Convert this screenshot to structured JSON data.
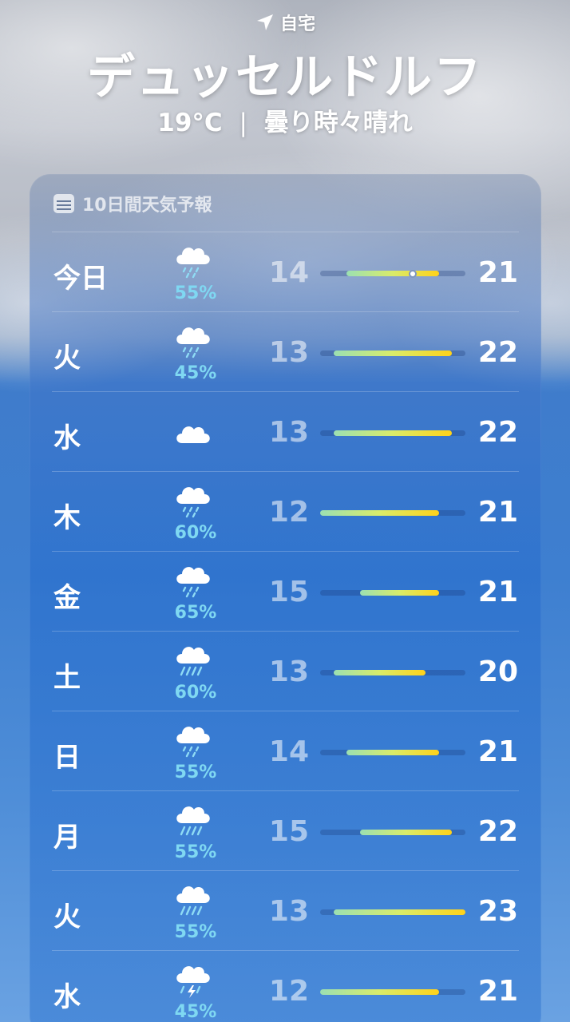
{
  "header": {
    "location_label": "自宅",
    "city": "デュッセルドルフ",
    "current_temp": "19°C",
    "separator": "|",
    "condition": "曇り時々晴れ"
  },
  "forecast": {
    "title": "10日間天気予報",
    "range_min": 12,
    "range_max": 23,
    "current_temp_value": 19,
    "days": [
      {
        "day": "今日",
        "icon": "cloud-rain-icon",
        "precip": "55%",
        "low": "14",
        "high": "21",
        "low_val": 14,
        "high_val": 21
      },
      {
        "day": "火",
        "icon": "cloud-rain-icon",
        "precip": "45%",
        "low": "13",
        "high": "22",
        "low_val": 13,
        "high_val": 22
      },
      {
        "day": "水",
        "icon": "cloud-icon",
        "precip": "",
        "low": "13",
        "high": "22",
        "low_val": 13,
        "high_val": 22
      },
      {
        "day": "木",
        "icon": "cloud-rain-icon",
        "precip": "60%",
        "low": "12",
        "high": "21",
        "low_val": 12,
        "high_val": 21
      },
      {
        "day": "金",
        "icon": "cloud-rain-icon",
        "precip": "65%",
        "low": "15",
        "high": "21",
        "low_val": 15,
        "high_val": 21
      },
      {
        "day": "土",
        "icon": "cloud-heavy-rain-icon",
        "precip": "60%",
        "low": "13",
        "high": "20",
        "low_val": 13,
        "high_val": 20
      },
      {
        "day": "日",
        "icon": "cloud-rain-icon",
        "precip": "55%",
        "low": "14",
        "high": "21",
        "low_val": 14,
        "high_val": 21
      },
      {
        "day": "月",
        "icon": "cloud-heavy-rain-icon",
        "precip": "55%",
        "low": "15",
        "high": "22",
        "low_val": 15,
        "high_val": 22
      },
      {
        "day": "火",
        "icon": "cloud-heavy-rain-icon",
        "precip": "55%",
        "low": "13",
        "high": "23",
        "low_val": 13,
        "high_val": 23
      },
      {
        "day": "水",
        "icon": "cloud-bolt-rain-icon",
        "precip": "45%",
        "low": "12",
        "high": "21",
        "low_val": 12,
        "high_val": 21
      }
    ]
  },
  "colors": {
    "precip_text": "#7fd8f2",
    "bar_cool": "#9be0b2",
    "bar_mid": "#d9ec6a",
    "bar_warm": "#ffd21a"
  }
}
